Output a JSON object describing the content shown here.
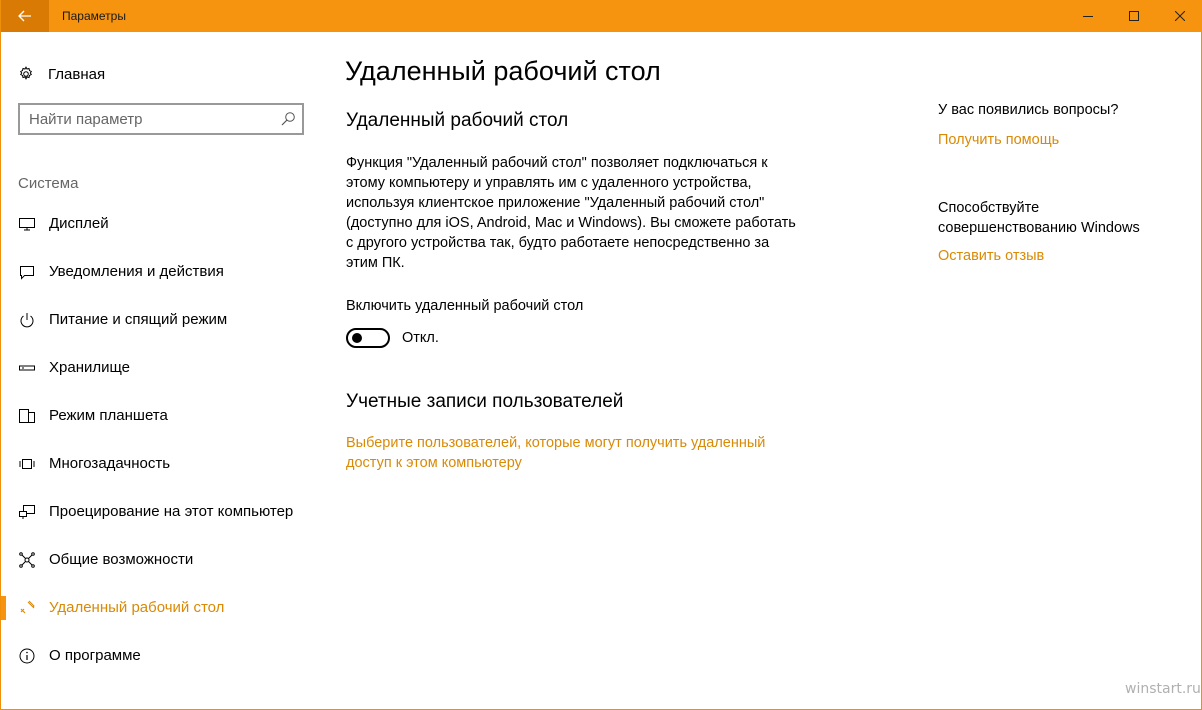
{
  "window": {
    "title": "Параметры"
  },
  "sidebar": {
    "home_label": "Главная",
    "search_placeholder": "Найти параметр",
    "section": "Система",
    "items": [
      {
        "label": "Дисплей",
        "icon": "monitor-icon"
      },
      {
        "label": "Уведомления и действия",
        "icon": "notifications-icon"
      },
      {
        "label": "Питание и спящий режим",
        "icon": "power-icon"
      },
      {
        "label": "Хранилище",
        "icon": "storage-icon"
      },
      {
        "label": "Режим планшета",
        "icon": "tablet-mode-icon"
      },
      {
        "label": "Многозадачность",
        "icon": "multitasking-icon"
      },
      {
        "label": "Проецирование на этот компьютер",
        "icon": "project-icon"
      },
      {
        "label": "Общие возможности",
        "icon": "shared-experiences-icon"
      },
      {
        "label": "Удаленный рабочий стол",
        "icon": "remote-desktop-icon",
        "active": true
      },
      {
        "label": "О программе",
        "icon": "about-icon"
      }
    ]
  },
  "main": {
    "page_title": "Удаленный рабочий стол",
    "section_title": "Удаленный рабочий стол",
    "description": "Функция \"Удаленный рабочий стол\" позволяет подключаться к этому компьютеру и управлять им с удаленного устройства, используя клиентское приложение \"Удаленный рабочий стол\" (доступно для iOS, Android, Mac и Windows). Вы сможете работать с другого устройства так, будто работаете непосредственно за этим ПК.",
    "toggle_label": "Включить удаленный рабочий стол",
    "toggle_state": "Откл.",
    "toggle_on": false,
    "accounts_title": "Учетные записи пользователей",
    "accounts_link": "Выберите пользователей, которые могут получить удаленный доступ к этом компьютеру"
  },
  "aside": {
    "questions": "У вас появились вопросы?",
    "help_link": "Получить помощь",
    "contribute": "Способствуйте совершенствованию Windows",
    "feedback_link": "Оставить отзыв"
  },
  "watermark": "winstart.ru",
  "colors": {
    "accent": "#f7940f",
    "accent_dark": "#d87a04",
    "link": "#d98a06"
  }
}
